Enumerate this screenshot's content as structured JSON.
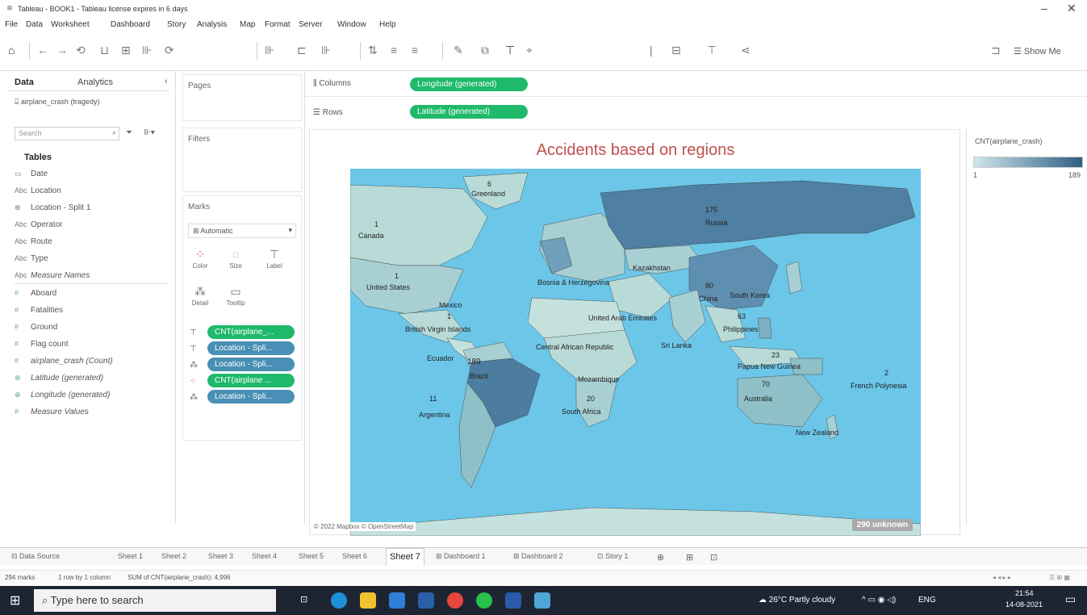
{
  "window": {
    "title": "Tableau - BOOK1 - Tableau license expires in 6 days",
    "controls": [
      "‒",
      "✕"
    ]
  },
  "menu": [
    "File",
    "Data",
    "Worksheet",
    "Dashboard",
    "Story",
    "Analysis",
    "Map",
    "Format",
    "Server",
    "Window",
    "Help"
  ],
  "toolbar": {
    "show_me": "Show Me"
  },
  "data_panel": {
    "tab_data": "Data",
    "tab_analytics": "Analytics",
    "datasource": "airplane_crash (tragedy)",
    "search_placeholder": "Search",
    "tables_header": "Tables",
    "fields": [
      {
        "icon": "▭",
        "name": "Date"
      },
      {
        "icon": "Abc",
        "name": "Location"
      },
      {
        "icon": "⊕",
        "name": "Location - Split 1"
      },
      {
        "icon": "Abc",
        "name": "Operator"
      },
      {
        "icon": "Abc",
        "name": "Route"
      },
      {
        "icon": "Abc",
        "name": "Type"
      },
      {
        "icon": "Abc",
        "name": "Measure Names"
      },
      {
        "icon": "#",
        "name": "Aboard"
      },
      {
        "icon": "#",
        "name": "Fatalities"
      },
      {
        "icon": "#",
        "name": "Ground"
      },
      {
        "icon": "#",
        "name": "Flag count"
      },
      {
        "icon": "#",
        "name": "airplane_crash (Count)"
      },
      {
        "icon": "⊕",
        "name": "Latitude (generated)"
      },
      {
        "icon": "⊕",
        "name": "Longitude (generated)"
      },
      {
        "icon": "#",
        "name": "Measure Values"
      }
    ]
  },
  "pages_label": "Pages",
  "filters_label": "Filters",
  "marks": {
    "title": "Marks",
    "type": "Automatic",
    "buttons": [
      "Color",
      "Size",
      "Label",
      "Detail",
      "Tooltip"
    ],
    "pills": [
      {
        "label": "CNT(airplane_...",
        "color": "green"
      },
      {
        "label": "Location - Spli...",
        "color": "blue"
      },
      {
        "label": "Location - Spli...",
        "color": "blue"
      },
      {
        "label": "CNT(airplane ...",
        "color": "green"
      },
      {
        "label": "Location - Spli...",
        "color": "blue"
      }
    ]
  },
  "shelves": {
    "columns_label": "Columns",
    "rows_label": "Rows",
    "columns_pill": "Longitude (generated)",
    "rows_pill": "Latitude (generated)"
  },
  "view": {
    "title": "Accidents based on regions",
    "unknown": "290 unknown",
    "attribution": "© 2022 Mapbox © OpenStreetMap"
  },
  "map_labels": [
    {
      "text": "Greenland",
      "val": "6"
    },
    {
      "text": "Canada",
      "val": "1"
    },
    {
      "text": "Russia",
      "val": "175"
    },
    {
      "text": "Kazakhstan",
      "val": ""
    },
    {
      "text": "United States",
      "val": "1"
    },
    {
      "text": "Bosnia & Herzegovina",
      "val": ""
    },
    {
      "text": "China",
      "val": "80"
    },
    {
      "text": "South Korea",
      "val": ""
    },
    {
      "text": "Mexico",
      "val": ""
    },
    {
      "text": "United Arab Emirates",
      "val": ""
    },
    {
      "text": "British Virgin Islands",
      "val": "1"
    },
    {
      "text": "Philippines",
      "val": "63"
    },
    {
      "text": "Central African Republic",
      "val": ""
    },
    {
      "text": "Sri Lanka",
      "val": ""
    },
    {
      "text": "Ecuador",
      "val": ""
    },
    {
      "text": "Brazil",
      "val": "189"
    },
    {
      "text": "Papua New Guinea",
      "val": "23"
    },
    {
      "text": "Mozambique",
      "val": ""
    },
    {
      "text": "French Polynesia",
      "val": "2"
    },
    {
      "text": "Australia",
      "val": "70"
    },
    {
      "text": "Argentina",
      "val": "11"
    },
    {
      "text": "South Africa",
      "val": "20"
    },
    {
      "text": "New Zealand",
      "val": ""
    }
  ],
  "legend": {
    "title": "CNT(airplane_crash)",
    "min": "1",
    "max": "189",
    "color_low": "#cfe6ea",
    "color_high": "#2f5f84"
  },
  "tabs": [
    "Data Source",
    "Sheet 1",
    "Sheet 2",
    "Sheet 3",
    "Sheet 4",
    "Sheet 5",
    "Sheet 6",
    "Sheet 7",
    "Dashboard 1",
    "Dashboard 2",
    "Story 1"
  ],
  "active_tab": "Sheet 7",
  "status": {
    "marks": "294 marks",
    "rows": "1 row by 1 column",
    "sum": "SUM of CNT(airplane_crash): 4,996"
  },
  "taskbar": {
    "search_placeholder": "Type here to search",
    "weather": "26°C Partly cloudy",
    "lang": "ENG",
    "time": "21:54",
    "date": "14-08-2021"
  }
}
